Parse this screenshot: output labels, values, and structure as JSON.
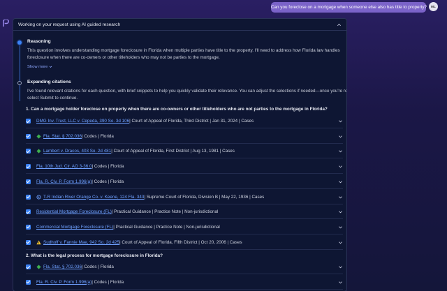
{
  "user_message": "Can you foreclose on a mortgage when someone else also has title to property?",
  "user_initials": "ML",
  "panel": {
    "header": "Working on your request using AI guided research"
  },
  "reasoning": {
    "title": "Reasoning",
    "text": "This question involves understanding mortgage foreclosure in Florida when multiple parties have title to the property. I'll need to address how Florida law handles foreclosure when there are co-owners or other titleholders who may not be parties to the mortgage.",
    "show_more": "Show more"
  },
  "citations": {
    "title": "Expanding citations",
    "intro_a": "I've found relevant citations for each question, with brief snippets to help you quickly validate their relevance. You can adjust the selections if needed—once you're ready,",
    "intro_b": "select Submit to continue.",
    "questions": [
      {
        "text": "1. Can a mortgage holder foreclose on property when there are co-owners or other titleholders who are not parties to the mortgage in Florida?",
        "items": [
          {
            "link": "DMG Inv. Trust, LLC v. Cepeda, 390 So. 3d 106",
            "rest": " | Court of Appeal of Florida, Third District | Jan 31, 2024 | Cases",
            "icon": "none"
          },
          {
            "link": "Fla. Stat. § 702.036",
            "rest": " | Codes | Florida",
            "icon": "green-diamond-icon"
          },
          {
            "link": "Lambert v. Dracos, 403 So. 2d 481",
            "rest": " | Court of Appeal of Florida, First District | Aug 13, 1981 | Cases",
            "icon": "green-diamond-icon"
          },
          {
            "link": "Fla. 10th Jud. Cir. AO 3-36.0",
            "rest": " | Codes | Florida",
            "icon": "none"
          },
          {
            "link": "Fla. R. Civ. P. Form 1.996(a)",
            "rest": " | Codes | Florida",
            "icon": "none"
          },
          {
            "link": "T-R Indian River Orange Co. v. Keene, 124 Fla. 343",
            "rest": " | Supreme Court of Florida, Division B | May 22, 1936 | Cases",
            "icon": "blue-circle-icon"
          },
          {
            "link": "Residential Mortgage Foreclosure (FL)",
            "rest": " | Practical Guidance | Practice Note | Non-jurisdictional",
            "icon": "none"
          },
          {
            "link": "Commercial Mortgage Foreclosure (FL)",
            "rest": " | Practical Guidance | Practice Note | Non-jurisdictional",
            "icon": "none"
          },
          {
            "link": "Sudhoff v. Fannie Mae, 942 So. 2d 425",
            "rest": " | Court of Appeal of Florida, Fifth District | Oct 20, 2006 | Cases",
            "icon": "yellow-warning-icon"
          }
        ]
      },
      {
        "text": "2. What is the legal process for mortgage foreclosure in Florida?",
        "items": [
          {
            "link": "Fla. Stat. § 702.036",
            "rest": " | Codes | Florida",
            "icon": "green-diamond-icon"
          },
          {
            "link": "Fla. R. Civ. P. Form 1.996(a)",
            "rest": " | Codes | Florida",
            "icon": "none"
          }
        ]
      }
    ]
  },
  "colors": {
    "accent": "#3b82f6",
    "link": "#6ea0ff",
    "bubble": "#7b63c9",
    "panel": "#0e1633"
  }
}
